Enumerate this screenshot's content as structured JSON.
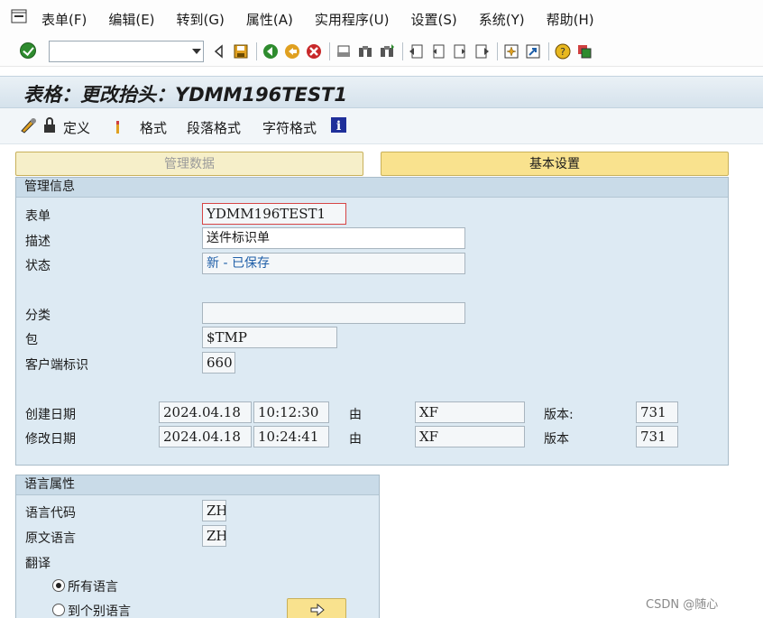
{
  "menu": {
    "items": [
      "表单(F)",
      "编辑(E)",
      "转到(G)",
      "属性(A)",
      "实用程序(U)",
      "设置(S)",
      "系统(Y)",
      "帮助(H)"
    ]
  },
  "page_title": "表格：更改抬头：YDMM196TEST1",
  "app_toolbar": {
    "define": "定义",
    "format": "格式",
    "paragraph_format": "段落格式",
    "character_format": "字符格式"
  },
  "tabs": {
    "admin_data": "管理数据",
    "basic_settings": "基本设置"
  },
  "admin_info": {
    "header": "管理信息",
    "form_label": "表单",
    "form_value": "YDMM196TEST1",
    "desc_label": "描述",
    "desc_value": "送件标识单",
    "status_label": "状态",
    "status_value": "新 - 已保存",
    "category_label": "分类",
    "category_value": "",
    "package_label": "包",
    "package_value": "$TMP",
    "client_label": "客户端标识",
    "client_value": "660",
    "created_label": "创建日期",
    "created_date": "2024.04.18",
    "created_time": "10:12:30",
    "by_label_1": "由",
    "created_by": "XF",
    "version_label_1": "版本:",
    "created_version": "731",
    "modified_label": "修改日期",
    "modified_date": "2024.04.18",
    "modified_time": "10:24:41",
    "by_label_2": "由",
    "modified_by": "XF",
    "version_label_2": "版本",
    "modified_version": "731"
  },
  "lang_attrs": {
    "header": "语言属性",
    "lang_code_label": "语言代码",
    "lang_code_value": "ZH",
    "orig_lang_label": "原文语言",
    "orig_lang_value": "ZH",
    "translate_label": "翻译",
    "radio_all": "所有语言",
    "radio_individual": "到个别语言"
  },
  "watermark": "CSDN @随心"
}
